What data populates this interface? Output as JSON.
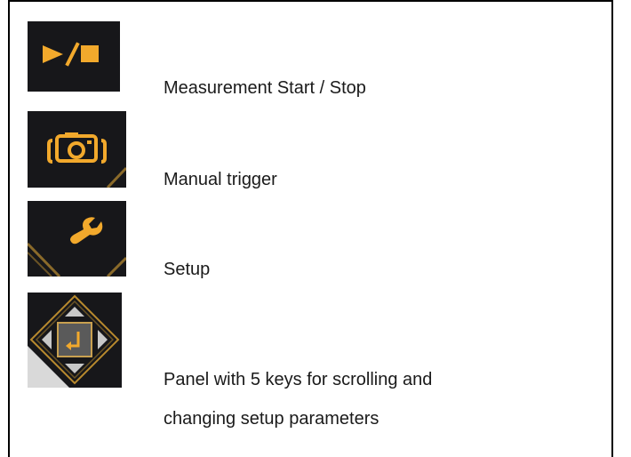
{
  "rows": [
    {
      "icon": "play-stop-icon",
      "label": "Measurement Start / Stop"
    },
    {
      "icon": "camera-icon",
      "label": "Manual trigger"
    },
    {
      "icon": "wrench-icon",
      "label": "Setup"
    },
    {
      "icon": "navigation-pad-icon",
      "label_line1": "Panel with 5 keys for scrolling and",
      "label_line2": "changing setup parameters"
    }
  ],
  "colors": {
    "icon_accent": "#f2a92c",
    "icon_background": "#17171a",
    "text": "#1a1a1a",
    "border": "#000000"
  }
}
